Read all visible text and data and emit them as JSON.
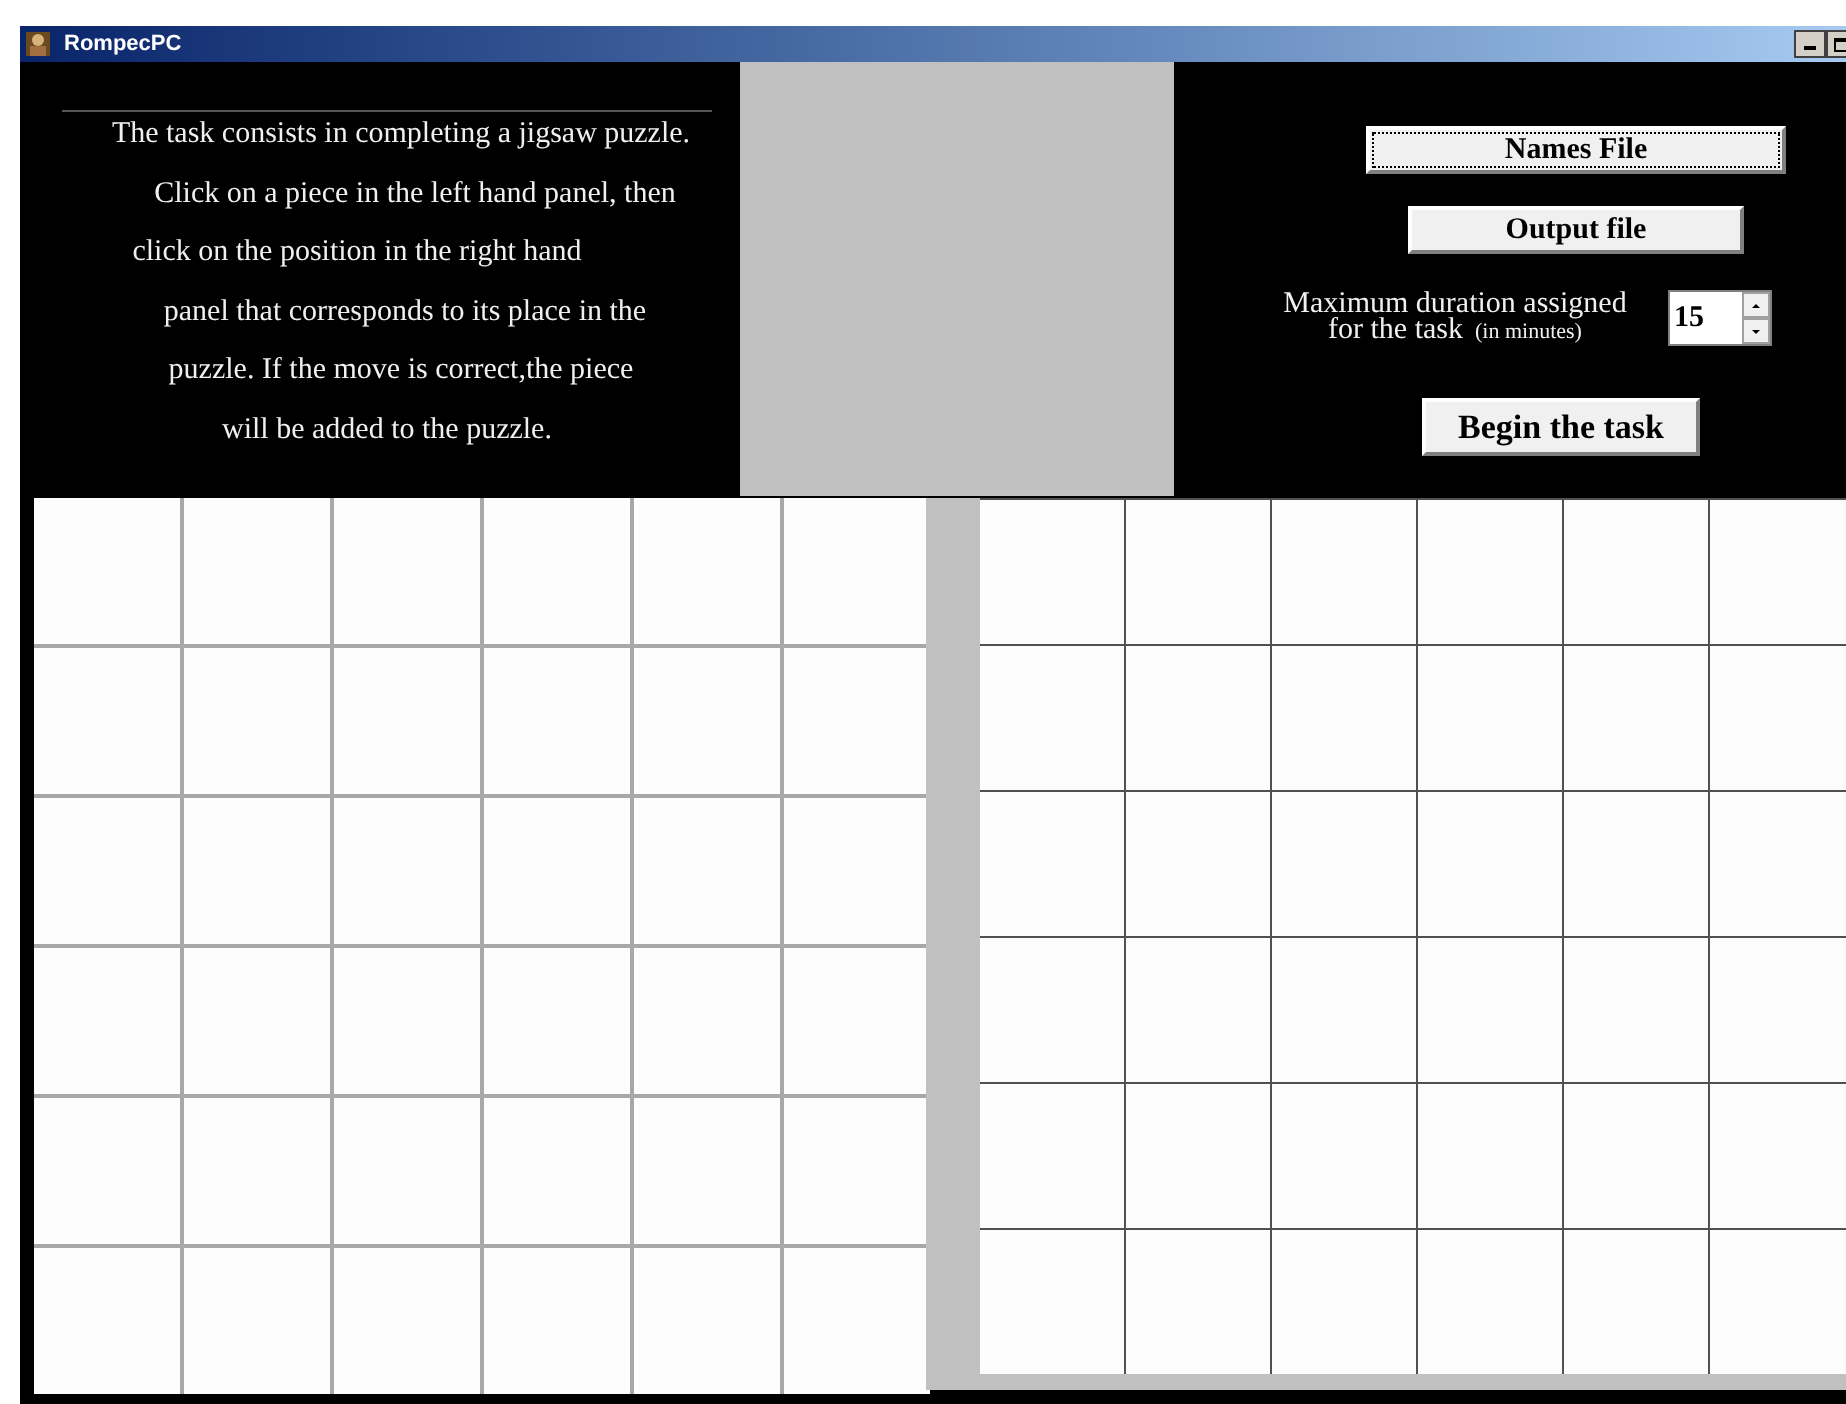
{
  "window": {
    "title": "RompecPC"
  },
  "instructions": [
    "The task consists in completing a jigsaw puzzle.",
    "Click on a piece in the left hand panel, then",
    "click on the position in the right hand",
    "panel that corresponds to its place in the",
    "puzzle. If the move is correct,the piece",
    "will be added to the puzzle."
  ],
  "names_file_button": {
    "label": "Names File",
    "focused": true
  },
  "output_file_button": {
    "label": "Output file",
    "focused": false
  },
  "duration": {
    "label_line_1": "Maximum duration assigned",
    "label_line_2": "for the task",
    "unit": "(in minutes)",
    "value": "15"
  },
  "begin_button": {
    "label": "Begin the task"
  }
}
